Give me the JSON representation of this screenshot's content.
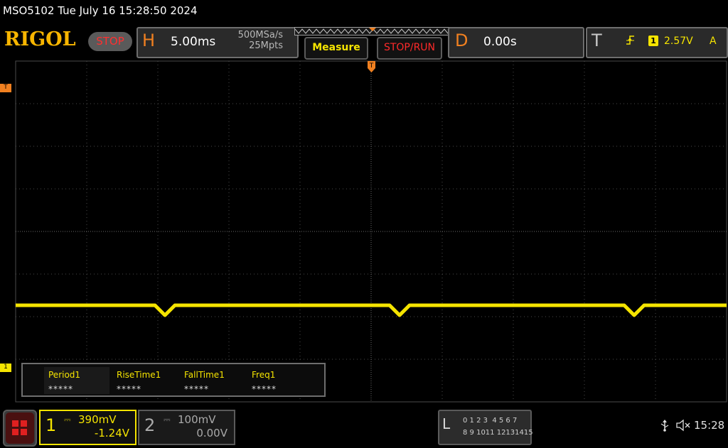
{
  "title": "MSO5102  Tue July 16 15:28:50 2024",
  "brand": "RIGOL",
  "run_state": "STOP",
  "horizontal": {
    "letter": "H",
    "timebase": "5.00ms",
    "sample_rate": "500MSa/s",
    "memory_depth": "25Mpts"
  },
  "buttons": {
    "measure": "Measure",
    "stop_run": "STOP/RUN"
  },
  "delay": {
    "letter": "D",
    "value": "0.00s"
  },
  "trigger": {
    "letter": "T",
    "source": "1",
    "level": "2.57V",
    "mode": "A",
    "marker": "T"
  },
  "channel1": {
    "number": "1",
    "scale": "390mV",
    "offset": "-1.24V",
    "marker": "1",
    "color": "#f5e400"
  },
  "channel2": {
    "number": "2",
    "scale": "100mV",
    "offset": "0.00V",
    "color": "#aaaaaa"
  },
  "measurements": [
    {
      "name": "Period1",
      "value": "*****"
    },
    {
      "name": "RiseTime1",
      "value": "*****"
    },
    {
      "name": "FallTime1",
      "value": "*****"
    },
    {
      "name": "Freq1",
      "value": "*****"
    }
  ],
  "logic": {
    "letter": "L",
    "row1": "0 1 2 3  4 5 6 7",
    "row2": "8 9 1011 12131415"
  },
  "status": {
    "clock": "15:28",
    "usb_icon": "usb-icon",
    "speaker_icon": "speaker-muted-icon"
  },
  "waveform": {
    "color": "#f5e400",
    "dips_at_ms": [
      -14.5,
      2.0,
      18.5
    ]
  }
}
